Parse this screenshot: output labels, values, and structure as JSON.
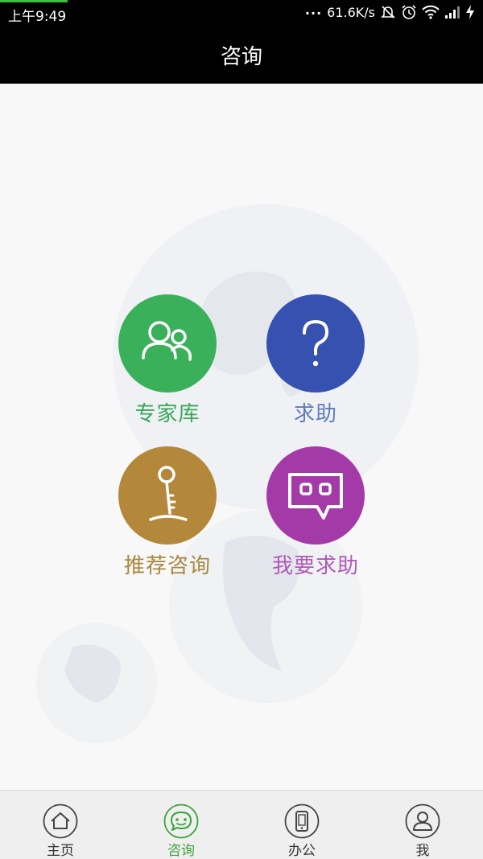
{
  "status_bar": {
    "time": "上午9:49",
    "dots": "...",
    "network_speed": "61.6K/s",
    "icons": [
      "mute-icon",
      "alarm-icon",
      "wifi-icon",
      "signal-icon",
      "charging-icon"
    ]
  },
  "header": {
    "title": "咨询"
  },
  "tiles": [
    {
      "label": "专家库",
      "icon": "experts-icon",
      "color": "#3bb05a",
      "label_color": "#3aa65a"
    },
    {
      "label": "求助",
      "icon": "question-icon",
      "color": "#3651b0",
      "label_color": "#5f7ac0"
    },
    {
      "label": "推荐咨询",
      "icon": "key-icon",
      "color": "#b3883a",
      "label_color": "#a98740"
    },
    {
      "label": "我要求助",
      "icon": "chat-icon",
      "color": "#a43aa8",
      "label_color": "#b05ab8"
    }
  ],
  "bottom_nav": {
    "items": [
      {
        "label": "主页",
        "icon": "home-icon",
        "active": false
      },
      {
        "label": "咨询",
        "icon": "chat-bubble-icon",
        "active": true
      },
      {
        "label": "办公",
        "icon": "phone-icon",
        "active": false
      },
      {
        "label": "我",
        "icon": "person-icon",
        "active": false
      }
    ]
  },
  "colors": {
    "active_tab": "#3aa33a"
  }
}
